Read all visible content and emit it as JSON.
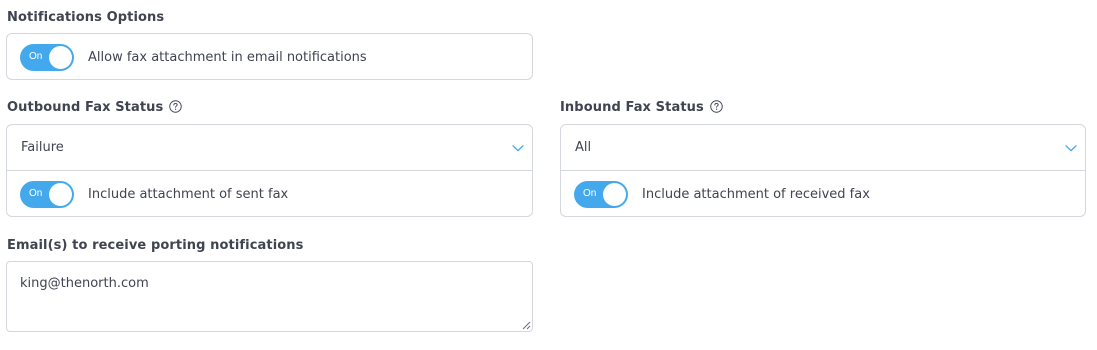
{
  "notifications": {
    "heading": "Notifications Options",
    "fax_attachment_toggle": {
      "state_text": "On",
      "label": "Allow fax attachment in email notifications"
    }
  },
  "outbound": {
    "heading": "Outbound Fax Status",
    "selected": "Failure",
    "toggle": {
      "state_text": "On",
      "label": "Include attachment of sent fax"
    }
  },
  "inbound": {
    "heading": "Inbound Fax Status",
    "selected": "All",
    "toggle": {
      "state_text": "On",
      "label": "Include attachment of received fax"
    }
  },
  "porting": {
    "heading": "Email(s) to receive porting notifications",
    "value": "king@thenorth.com"
  },
  "colors": {
    "accent": "#44a9ec",
    "text": "#3f4451",
    "border": "#d4d7dc"
  },
  "icons": {
    "help": "question-circle-icon",
    "dropdown": "chevron-down-icon",
    "resize": "resize-grip-icon"
  }
}
